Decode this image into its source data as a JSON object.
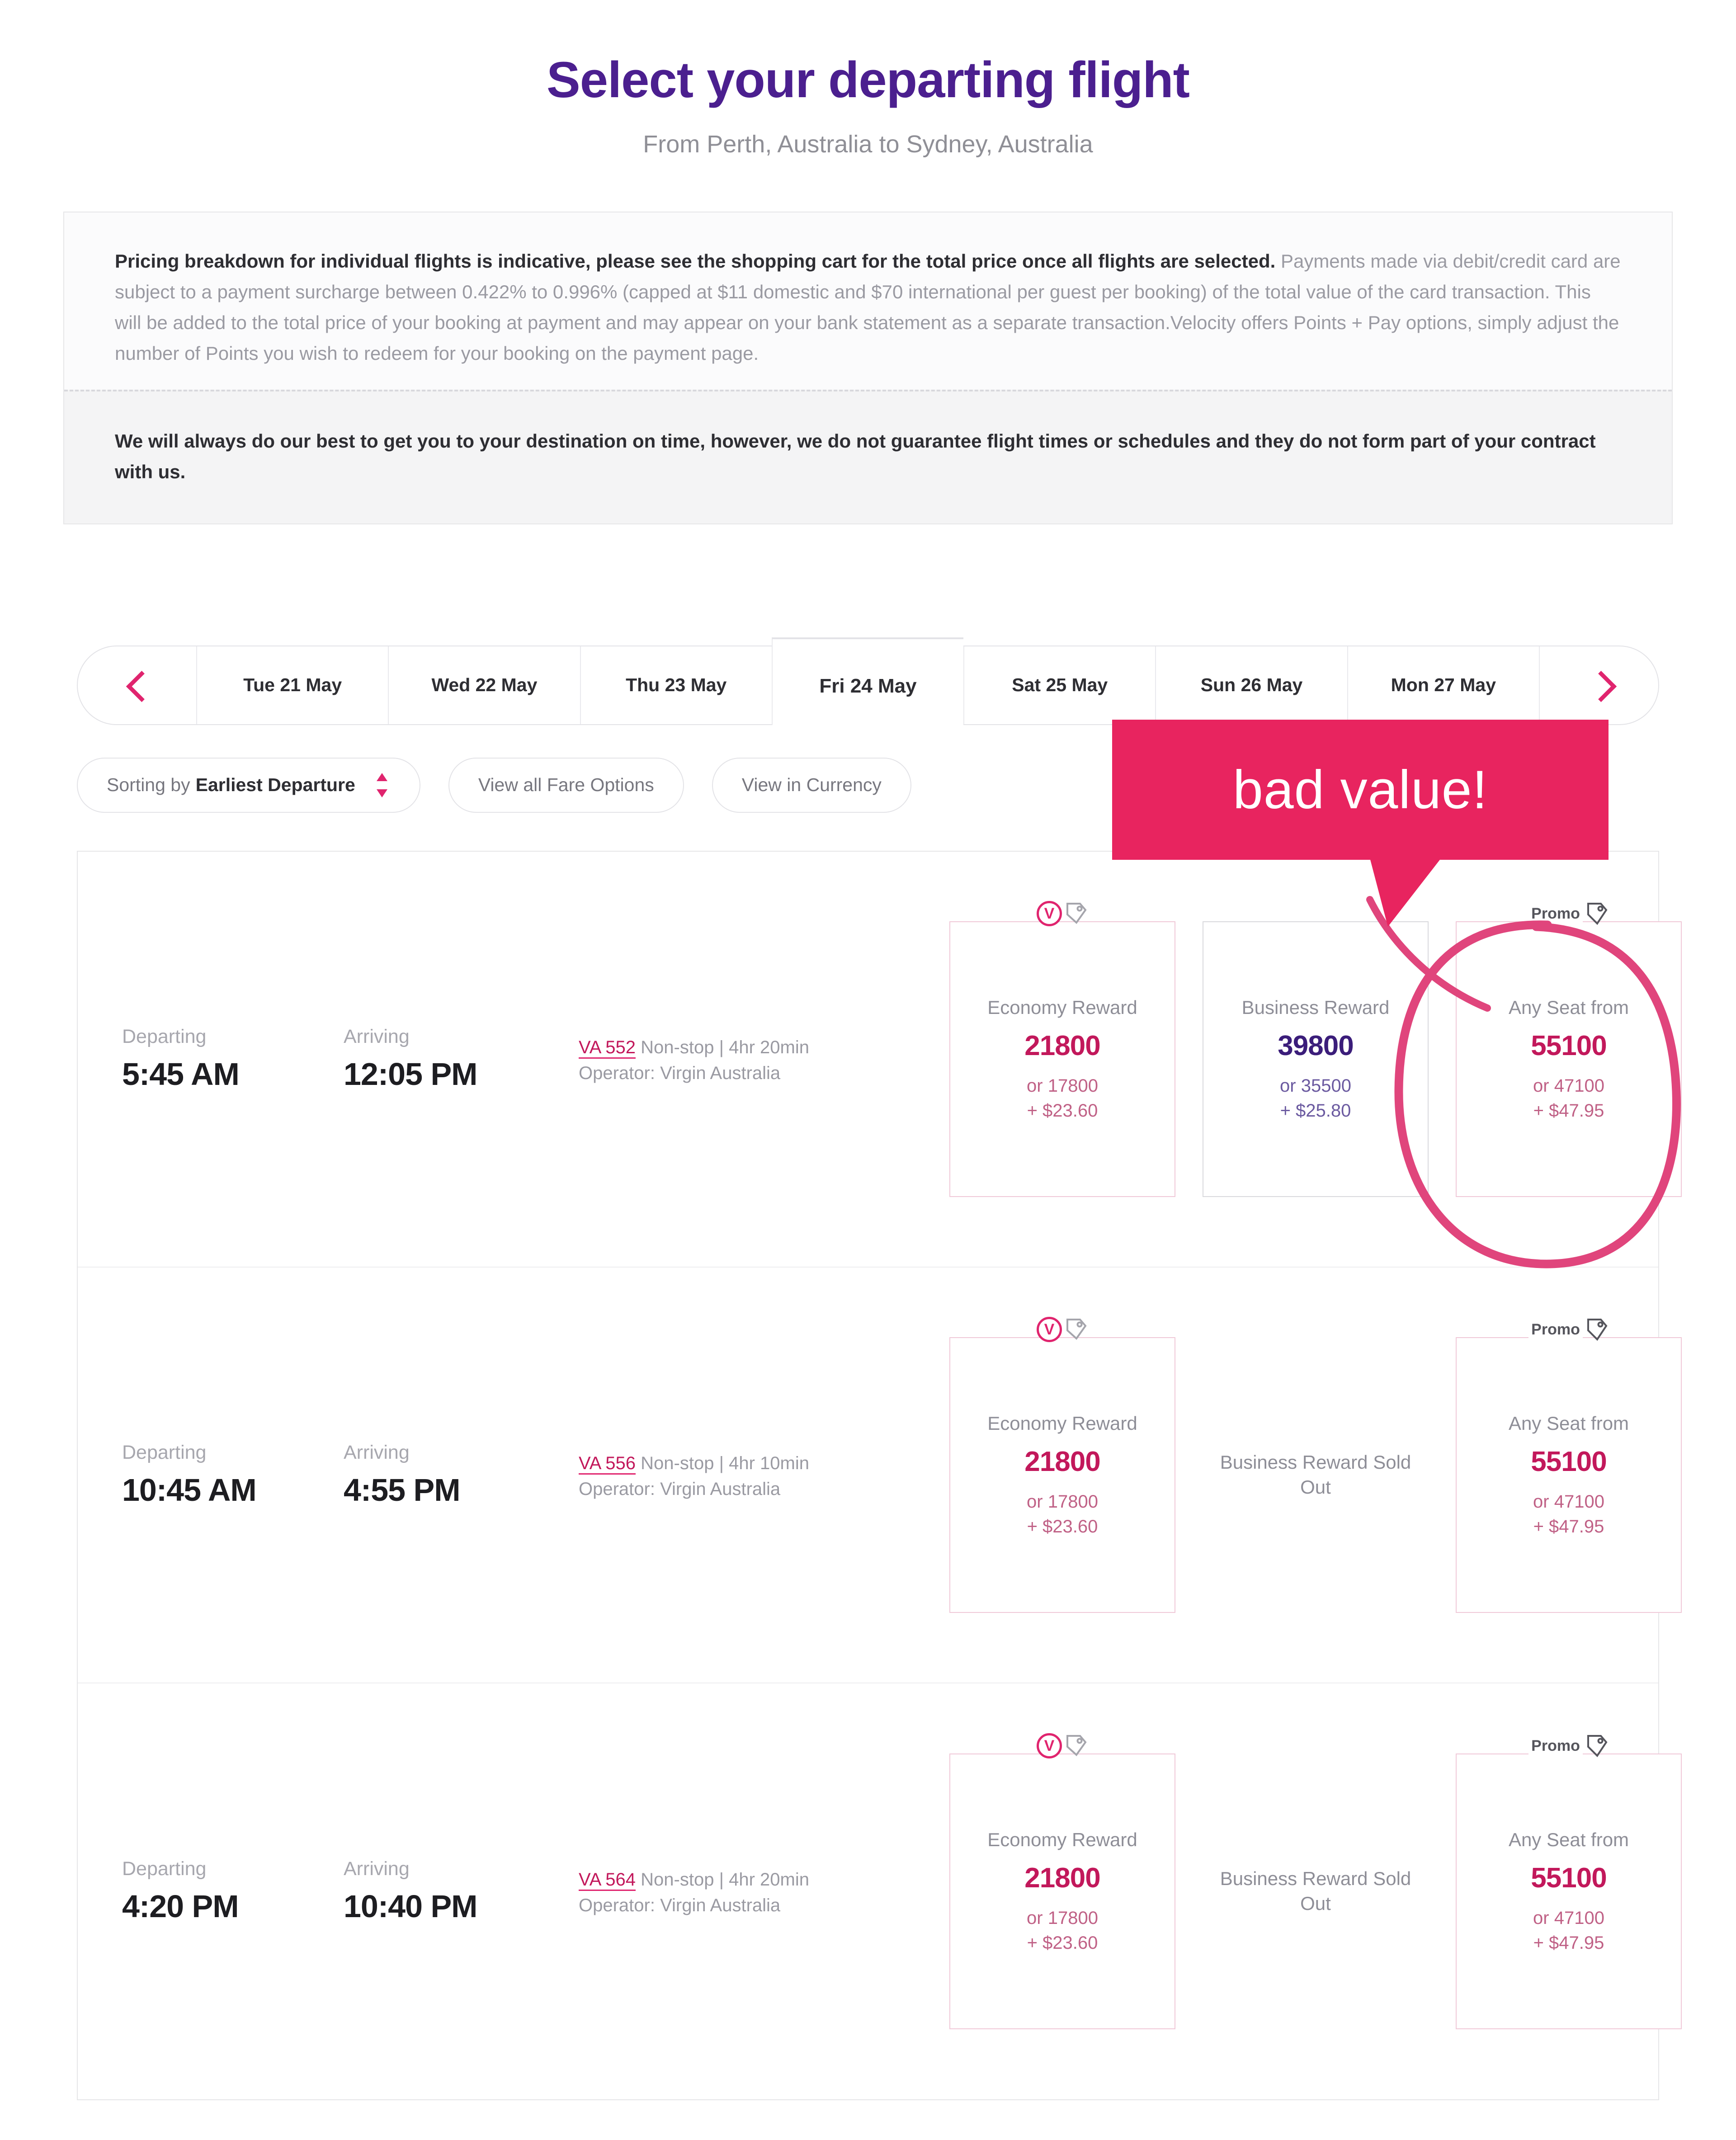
{
  "header": {
    "title": "Select your departing flight",
    "subtitle": "From Perth, Australia to Sydney, Australia"
  },
  "notices": {
    "pricing_bold": "Pricing breakdown for individual flights is indicative, please see the shopping cart for the total price once all flights are selected.",
    "pricing_rest": " Payments made via debit/credit card are subject to a payment surcharge between 0.422% to 0.996% (capped at $11 domestic and $70 international per guest per booking) of the total value of the card transaction. This will be added to the total price of your booking at payment and may appear on your bank statement as a separate transaction.Velocity offers Points + Pay options, simply adjust the number of Points you wish to redeem for your booking on the payment page.",
    "schedule_note": "We will always do our best to get you to your destination on time, however, we do not guarantee flight times or schedules and they do not form part of your contract with us."
  },
  "date_strip": {
    "prev_icon": "chevron-left-icon",
    "next_icon": "chevron-right-icon",
    "tabs": [
      {
        "label": "Tue 21 May",
        "active": false
      },
      {
        "label": "Wed 22 May",
        "active": false
      },
      {
        "label": "Thu 23 May",
        "active": false
      },
      {
        "label": "Fri 24 May",
        "active": true
      },
      {
        "label": "Sat 25 May",
        "active": false
      },
      {
        "label": "Sun 26 May",
        "active": false
      },
      {
        "label": "Mon 27 May",
        "active": false
      }
    ]
  },
  "filters": {
    "sort_prefix": "Sorting by",
    "sort_value": "Earliest Departure",
    "sort_icon": "sort-updown-icon",
    "fare_options_label": "View all Fare Options",
    "currency_label": "View in Currency"
  },
  "annotation": {
    "text": "bad value!",
    "color": "#e8245f",
    "circle_color": "#e0457c",
    "target": "Any Seat from 55100 on flight VA 552"
  },
  "labels": {
    "departing": "Departing",
    "arriving": "Arriving",
    "operator_prefix": "Operator:",
    "economy_tag": "velocity-badge-icon",
    "promo_tag": "Promo"
  },
  "flights": [
    {
      "departing": "5:45 AM",
      "arriving": "12:05 PM",
      "flight_no": "VA 552",
      "stops_duration": "Non-stop | 4hr 20min",
      "operator": "Operator: Virgin Australia",
      "fares": [
        {
          "kind": "economy",
          "tag": "velocity",
          "title": "Economy Reward",
          "points": "21800",
          "alt_points": "or 17800",
          "alt_cash": "+ $23.60",
          "sold_out": false
        },
        {
          "kind": "business",
          "tag": null,
          "title": "Business Reward",
          "points": "39800",
          "alt_points": "or 35500",
          "alt_cash": "+ $25.80",
          "sold_out": false
        },
        {
          "kind": "promo",
          "tag": "Promo",
          "title": "Any Seat from",
          "points": "55100",
          "alt_points": "or 47100",
          "alt_cash": "+ $47.95",
          "sold_out": false
        }
      ]
    },
    {
      "departing": "10:45 AM",
      "arriving": "4:55 PM",
      "flight_no": "VA 556",
      "stops_duration": "Non-stop | 4hr 10min",
      "operator": "Operator: Virgin Australia",
      "fares": [
        {
          "kind": "economy",
          "tag": "velocity",
          "title": "Economy Reward",
          "points": "21800",
          "alt_points": "or 17800",
          "alt_cash": "+ $23.60",
          "sold_out": false
        },
        {
          "kind": "business",
          "tag": null,
          "title": "Business Reward Sold Out",
          "points": "",
          "alt_points": "",
          "alt_cash": "",
          "sold_out": true
        },
        {
          "kind": "promo",
          "tag": "Promo",
          "title": "Any Seat from",
          "points": "55100",
          "alt_points": "or 47100",
          "alt_cash": "+ $47.95",
          "sold_out": false
        }
      ]
    },
    {
      "departing": "4:20 PM",
      "arriving": "10:40 PM",
      "flight_no": "VA 564",
      "stops_duration": "Non-stop | 4hr 20min",
      "operator": "Operator: Virgin Australia",
      "fares": [
        {
          "kind": "economy",
          "tag": "velocity",
          "title": "Economy Reward",
          "points": "21800",
          "alt_points": "or 17800",
          "alt_cash": "+ $23.60",
          "sold_out": false
        },
        {
          "kind": "business",
          "tag": null,
          "title": "Business Reward Sold Out",
          "points": "",
          "alt_points": "",
          "alt_cash": "",
          "sold_out": true
        },
        {
          "kind": "promo",
          "tag": "Promo",
          "title": "Any Seat from",
          "points": "55100",
          "alt_points": "or 47100",
          "alt_cash": "+ $47.95",
          "sold_out": false
        }
      ]
    }
  ]
}
